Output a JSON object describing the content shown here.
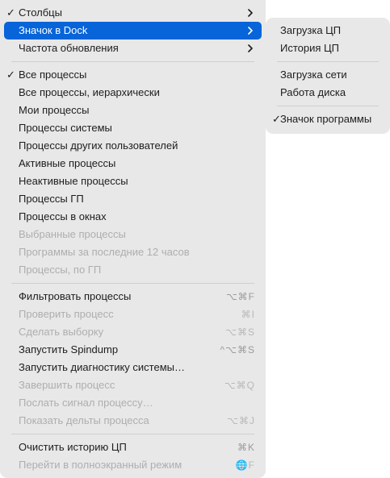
{
  "menu": {
    "section1": [
      {
        "label": "Столбцы",
        "checked": true,
        "arrow": true
      },
      {
        "label": "Значок в Dock",
        "checked": false,
        "arrow": true,
        "selected": true
      },
      {
        "label": "Частота обновления",
        "checked": false,
        "arrow": true
      }
    ],
    "section2": [
      {
        "label": "Все процессы",
        "checked": true
      },
      {
        "label": "Все процессы, иерархически"
      },
      {
        "label": "Мои процессы"
      },
      {
        "label": "Процессы системы"
      },
      {
        "label": "Процессы других пользователей"
      },
      {
        "label": "Активные процессы"
      },
      {
        "label": "Неактивные процессы"
      },
      {
        "label": "Процессы ГП"
      },
      {
        "label": "Процессы в окнах"
      },
      {
        "label": "Выбранные процессы",
        "disabled": true
      },
      {
        "label": "Программы за последние 12 часов",
        "disabled": true
      },
      {
        "label": "Процессы, по ГП",
        "disabled": true
      }
    ],
    "section3": [
      {
        "label": "Фильтровать процессы",
        "shortcut": "⌥⌘F"
      },
      {
        "label": "Проверить процесс",
        "shortcut": "⌘I",
        "disabled": true
      },
      {
        "label": "Сделать выборку",
        "shortcut": "⌥⌘S",
        "disabled": true
      },
      {
        "label": "Запустить Spindump",
        "shortcut": "^⌥⌘S"
      },
      {
        "label": "Запустить диагностику системы…"
      },
      {
        "label": "Завершить процесс",
        "shortcut": "⌥⌘Q",
        "disabled": true
      },
      {
        "label": "Послать сигнал процессу…",
        "disabled": true
      },
      {
        "label": "Показать дельты процесса",
        "shortcut": "⌥⌘J",
        "disabled": true
      }
    ],
    "section4": [
      {
        "label": "Очистить историю ЦП",
        "shortcut": "⌘K"
      },
      {
        "label": "Перейти в полноэкранный режим",
        "shortcut": "🌐F",
        "disabled": true
      }
    ]
  },
  "submenu": {
    "section1": [
      {
        "label": "Загрузка ЦП"
      },
      {
        "label": "История ЦП"
      }
    ],
    "section2": [
      {
        "label": "Загрузка сети"
      },
      {
        "label": "Работа диска"
      }
    ],
    "section3": [
      {
        "label": "Значок программы",
        "checked": true
      }
    ]
  },
  "glyphs": {
    "check": "✓"
  },
  "colors": {
    "menu_background": "#e8e8e8",
    "selection": "#0764d9",
    "text": "#1d1d1d",
    "disabled_text": "#aeaeae"
  }
}
